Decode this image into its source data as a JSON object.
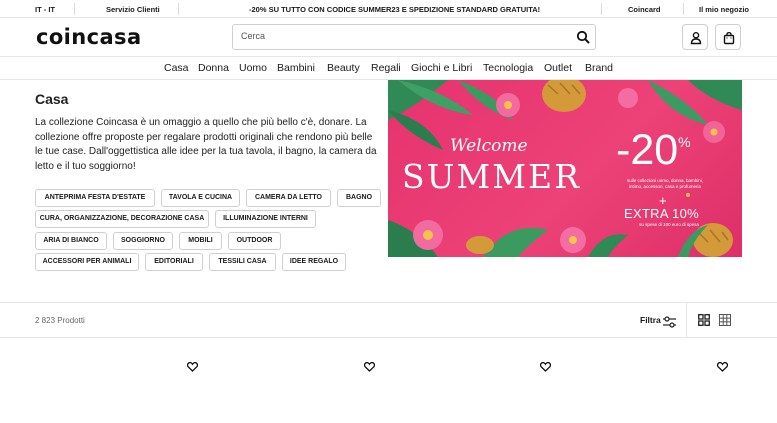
{
  "topbar": {
    "locale": "IT - IT",
    "customer_service": "Servizio Clienti",
    "promo": "-20% SU TUTTO CON CODICE SUMMER23 E SPEDIZIONE STANDARD GRATUITA!",
    "coincard": "Coincard",
    "my_store": "Il mio negozio"
  },
  "header": {
    "logo": "coincasa",
    "search_placeholder": "Cerca"
  },
  "nav": [
    "Casa",
    "Donna",
    "Uomo",
    "Bambini",
    "Beauty",
    "Regali",
    "Giochi e Libri",
    "Tecnologia",
    "Outlet",
    "Brand"
  ],
  "category": {
    "title": "Casa",
    "description": "La collezione Coincasa è un omaggio a quello che più bello c'è, donare. La collezione offre proposte per regalare prodotti originali che rendono più belle le tue case. Dall'oggettistica alle idee per la tua tavola, il bagno, la camera da letto e il tuo soggiorno!"
  },
  "chips": [
    "ANTEPRIMA FESTA D'ESTATE",
    "TAVOLA E CUCINA",
    "CAMERA DA LETTO",
    "BAGNO",
    "CURA, ORGANIZZAZIONE, DECORAZIONE CASA",
    "ILLUMINAZIONE INTERNI",
    "ARIA DI BIANCO",
    "SOGGIORNO",
    "MOBILI",
    "OUTDOOR",
    "ACCESSORI PER ANIMALI",
    "EDITORIALI",
    "TESSILI CASA",
    "IDEE REGALO"
  ],
  "banner": {
    "welcome": "Welcome",
    "summer": "SUMMER",
    "discount": "-20",
    "percent": "%",
    "fine_print_1": "sulle collezioni uomo, donna, bambini, intimo, accessori, casa e profumeria",
    "plus": "+",
    "extra": "EXTRA 10%",
    "fine_print_2": "su spese di 100 euro di spesa",
    "colors": {
      "background": "#e6326e",
      "text": "#ffffff"
    }
  },
  "results": {
    "count": "2 823 Prodotti",
    "filter_label": "Filtra"
  },
  "icons": {
    "search": "search-icon",
    "account": "user-icon",
    "bag": "shopping-bag-icon",
    "filter": "filter-sliders-icon",
    "grid_large": "grid-2x2-icon",
    "grid_small": "grid-3x3-icon",
    "wishlist": "heart-icon"
  }
}
